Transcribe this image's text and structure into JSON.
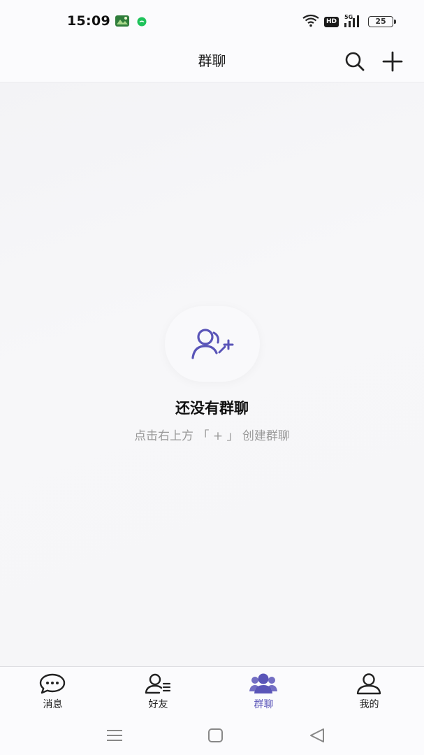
{
  "status_bar": {
    "time": "15:09",
    "hd_label": "HD",
    "network_label": "5G",
    "battery": "25",
    "icons": [
      "gallery-app-icon",
      "wechat-app-icon",
      "wifi-icon",
      "hd-icon",
      "signal-5g-icon",
      "battery-icon"
    ]
  },
  "header": {
    "title": "群聊",
    "icons": [
      "search-icon",
      "plus-icon"
    ]
  },
  "empty_state": {
    "icon": "add-group-user-icon",
    "title": "还没有群聊",
    "hint": "点击右上方 「 + 」 创建群聊"
  },
  "bottom_nav": {
    "tabs": [
      {
        "label": "消息",
        "icon": "chat-bubble-icon",
        "active": false
      },
      {
        "label": "好友",
        "icon": "friends-list-icon",
        "active": false
      },
      {
        "label": "群聊",
        "icon": "group-icon",
        "active": true
      },
      {
        "label": "我的",
        "icon": "profile-icon",
        "active": false
      }
    ]
  },
  "system_nav": {
    "buttons": [
      "menu-icon",
      "home-icon",
      "back-icon"
    ]
  },
  "colors": {
    "accent": "#5a55b8",
    "background": "#f6f6f8",
    "hint_text": "#999999"
  }
}
